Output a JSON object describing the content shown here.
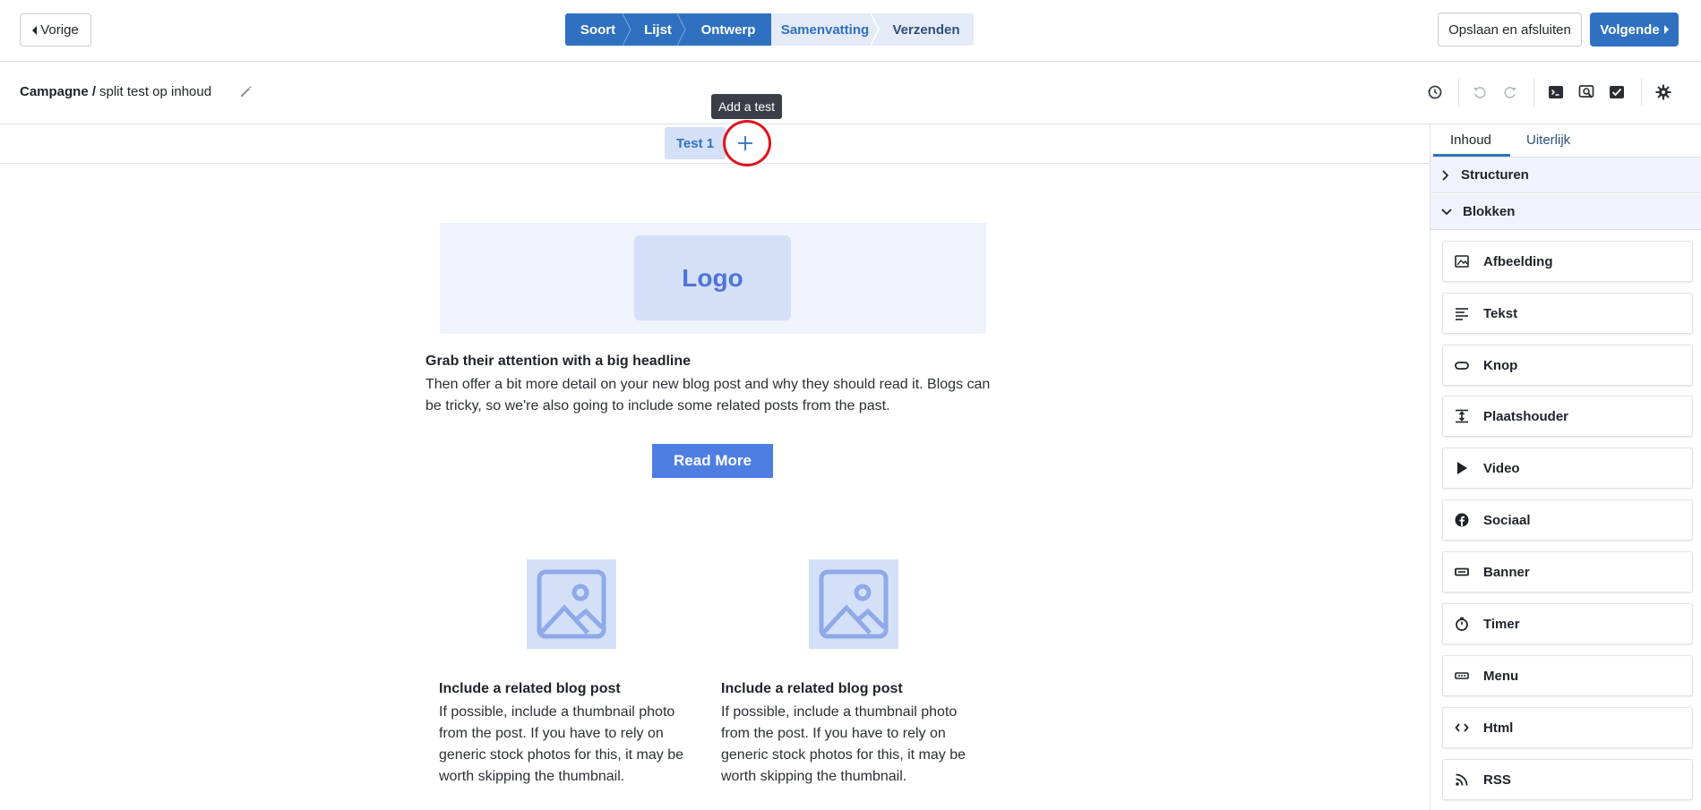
{
  "topbar": {
    "back_label": "Vorige",
    "steps": [
      {
        "label": "Soort",
        "state": "done"
      },
      {
        "label": "Lijst",
        "state": "done"
      },
      {
        "label": "Ontwerp",
        "state": "done"
      },
      {
        "label": "Samenvatting",
        "state": "current"
      },
      {
        "label": "Verzenden",
        "state": "todo"
      }
    ],
    "save_label": "Opslaan en afsluiten",
    "next_label": "Volgende"
  },
  "subbar": {
    "breadcrumb_label": "Campagne /",
    "campaign_name": "split test op inhoud",
    "tools": [
      "history-icon",
      "undo-icon",
      "redo-icon",
      "terminal-icon",
      "preview-icon",
      "test-send-icon",
      "settings-icon"
    ]
  },
  "tooltip": "Add a test",
  "tests": {
    "tab_label": "Test 1"
  },
  "canvas": {
    "logo_text": "Logo",
    "headline": "Grab their attention with a big headline",
    "intro": "Then offer a bit more detail on your new blog post and why they should read it. Blogs can be tricky, so we're also going to include some related posts from the past.",
    "cta_label": "Read More",
    "posts": [
      {
        "title": "Include a related blog post",
        "body": "If possible, include a thumbnail photo from the post. If you have to rely on generic stock photos for this, it may be worth skipping the thumbnail."
      },
      {
        "title": "Include a related blog post",
        "body": "If possible, include a thumbnail photo from the post. If you have to rely on generic stock photos for this, it may be worth skipping the thumbnail."
      }
    ]
  },
  "panel": {
    "tabs": [
      "Inhoud",
      "Uiterlijk"
    ],
    "sections": [
      "Structuren",
      "Blokken"
    ],
    "blocks": [
      {
        "label": "Afbeelding",
        "icon": "image-icon"
      },
      {
        "label": "Tekst",
        "icon": "text-icon"
      },
      {
        "label": "Knop",
        "icon": "button-icon"
      },
      {
        "label": "Plaatshouder",
        "icon": "spacer-icon"
      },
      {
        "label": "Video",
        "icon": "play-icon"
      },
      {
        "label": "Sociaal",
        "icon": "facebook-icon"
      },
      {
        "label": "Banner",
        "icon": "banner-icon"
      },
      {
        "label": "Timer",
        "icon": "timer-icon"
      },
      {
        "label": "Menu",
        "icon": "menu-icon"
      },
      {
        "label": "Html",
        "icon": "code-icon"
      },
      {
        "label": "RSS",
        "icon": "rss-icon"
      }
    ]
  },
  "colors": {
    "primary": "#2f71c0",
    "cta": "#4f7ee2",
    "highlight_ring": "#e0141c"
  }
}
